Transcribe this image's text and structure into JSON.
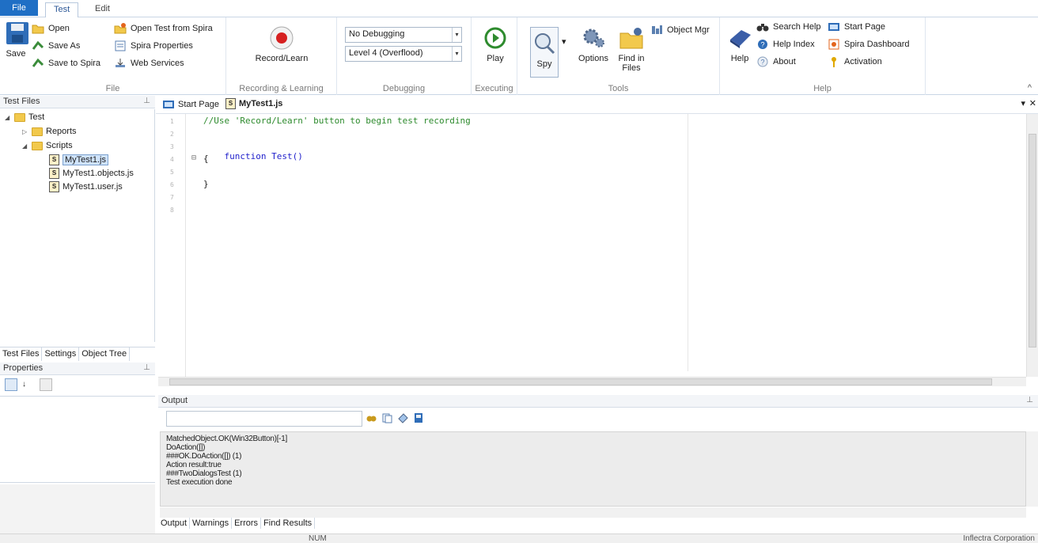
{
  "ribbon_tabs": {
    "file": "File",
    "test": "Test",
    "edit": "Edit"
  },
  "ribbon": {
    "file_group": {
      "label": "File",
      "save": "Save",
      "open": "Open",
      "save_as": "Save As",
      "save_to_spira": "Save to Spira",
      "open_from_spira": "Open Test from Spira",
      "spira_properties": "Spira Properties",
      "web_services": "Web Services"
    },
    "recording_group": {
      "label": "Recording & Learning",
      "record": "Record/Learn"
    },
    "debugging_group": {
      "label": "Debugging",
      "debug_mode": "No Debugging",
      "level": "Level 4 (Overflood)"
    },
    "executing_group": {
      "label": "Executing",
      "play": "Play"
    },
    "tools_group": {
      "label": "Tools",
      "spy": "Spy",
      "options": "Options",
      "find_in_files": "Find in\nFiles",
      "object_mgr": "Object Mgr"
    },
    "help_group": {
      "label": "Help",
      "help": "Help",
      "search_help": "Search Help",
      "help_index": "Help Index",
      "about": "About",
      "start_page": "Start Page",
      "spira_dashboard": "Spira Dashboard",
      "activation": "Activation"
    }
  },
  "test_files": {
    "title": "Test Files",
    "tree": {
      "root": "Test",
      "reports": "Reports",
      "scripts": "Scripts",
      "files": [
        "MyTest1.js",
        "MyTest1.objects.js",
        "MyTest1.user.js"
      ]
    },
    "tabs": [
      "Test Files",
      "Settings",
      "Object Tree"
    ]
  },
  "properties": {
    "title": "Properties"
  },
  "editor": {
    "tabs": [
      "Start Page",
      "MyTest1.js"
    ],
    "line_numbers": [
      "1",
      "2",
      "3",
      "4",
      "5",
      "6",
      "7",
      "8"
    ],
    "comment": "//Use 'Record/Learn' button to begin test recording",
    "keyword": "function",
    "func_name": "Test()",
    "open_brace": "{",
    "close_brace": "}"
  },
  "output": {
    "title": "Output",
    "lines": [
      "MatchedObject.OK(Win32Button)[-1]",
      "DoAction([])",
      "###OK.DoAction([]) (1)",
      "Action result:true",
      "###TwoDialogsTest (1)",
      "Test execution done"
    ],
    "tabs": [
      "Output",
      "Warnings",
      "Errors",
      "Find Results"
    ]
  },
  "status": {
    "num": "NUM",
    "company": "Inflectra Corporation"
  },
  "colors": {
    "accent": "#1f6fc5",
    "comment": "#2e8b2e",
    "keyword": "#2222cc"
  }
}
